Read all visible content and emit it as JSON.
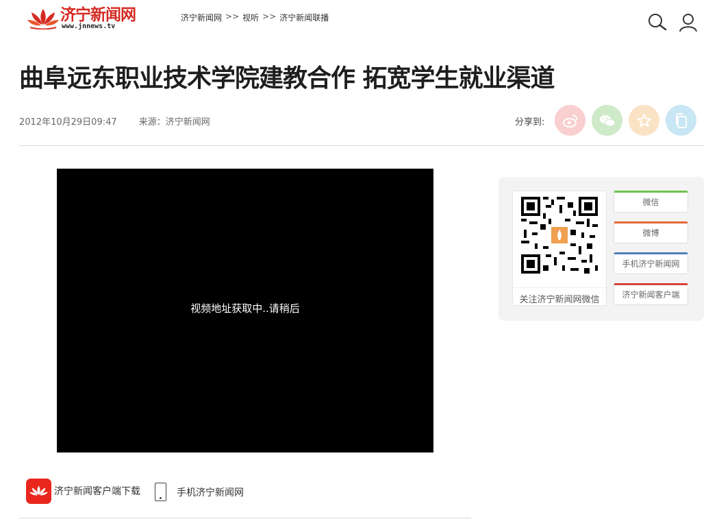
{
  "header": {
    "logo_text": "济宁新闻网",
    "logo_url": "www.jnnews.tv",
    "breadcrumb": [
      "济宁新闻网",
      "视听",
      "济宁新闻联播"
    ],
    "breadcrumb_sep": ">>",
    "icons": [
      "search-icon",
      "user-icon"
    ]
  },
  "article": {
    "title": "曲阜远东职业技术学院建教合作 拓宽学生就业渠道",
    "date": "2012年10月29日09:47",
    "source": "来源：济宁新闻网"
  },
  "share": {
    "label": "分享到:",
    "buttons": [
      "weibo-icon",
      "wechat-icon",
      "favorite-icon",
      "copy-icon"
    ],
    "colors": {
      "weibo": "#f9cfcf",
      "wechat": "#cfeac8",
      "fav": "#fae3c5",
      "copy": "#c8e6f3"
    }
  },
  "video": {
    "message": "视频地址获取中..请稍后"
  },
  "bottom_links": {
    "app": "济宁新闻客户端下载",
    "mobile": "手机济宁新闻网"
  },
  "follow_panel": {
    "qr_caption": "关注济宁新闻网微信",
    "buttons": [
      "微信",
      "微博",
      "手机济宁新闻网",
      "济宁新闻客户端"
    ]
  },
  "colors": {
    "brand_red": "#d42a22"
  }
}
